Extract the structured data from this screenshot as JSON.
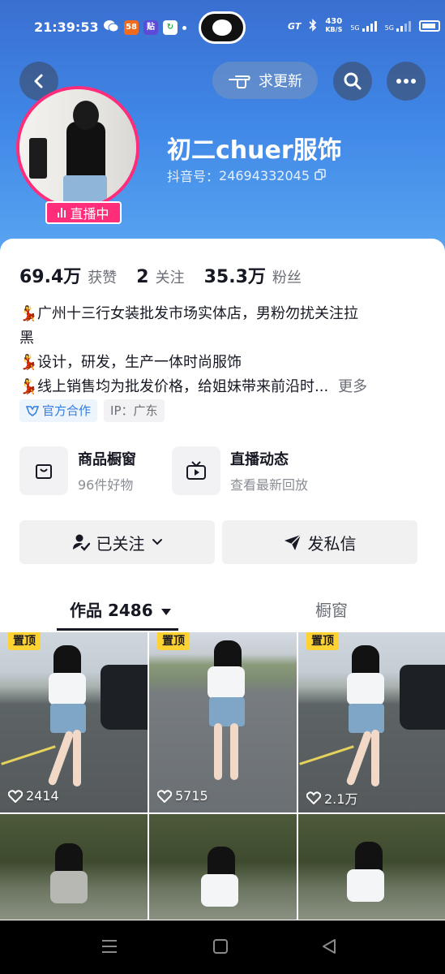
{
  "status_bar": {
    "time": "21:39:53",
    "net_speed": "430\nKB/S",
    "net_speed_value": "430",
    "net_speed_unit": "KB/S",
    "network_1": "5G",
    "network_2": "5G"
  },
  "header": {
    "update_request_label": "求更新",
    "profile_name": "初二chuer服饰",
    "douyin_id_label": "抖音号：",
    "douyin_id": "24694332045",
    "live_badge": "直播中"
  },
  "stats": [
    {
      "value": "69.4万",
      "label": "获赞"
    },
    {
      "value": "2",
      "label": "关注"
    },
    {
      "value": "35.3万",
      "label": "粉丝"
    }
  ],
  "bio": {
    "lines": [
      "广州十三行女装批发市场实体店，男粉勿扰关注拉",
      "黑",
      "设计，研发，生产一体时尚服饰",
      "线上销售均为批发价格，给姐妹带来前沿时..."
    ],
    "more_label": "更多"
  },
  "tags": {
    "official": "官方合作",
    "ip": "IP：广东"
  },
  "shortcuts": [
    {
      "title": "商品橱窗",
      "subtitle": "96件好物",
      "icon": "shopping-bag-icon"
    },
    {
      "title": "直播动态",
      "subtitle": "查看最新回放",
      "icon": "live-tv-icon"
    }
  ],
  "actions": {
    "follow_label": "已关注",
    "message_label": "发私信"
  },
  "tabs": {
    "works_label": "作品 2486",
    "showcase_label": "橱窗"
  },
  "videos": [
    {
      "pinned_label": "置顶",
      "likes": "2414"
    },
    {
      "pinned_label": "置顶",
      "likes": "5715"
    },
    {
      "pinned_label": "置顶",
      "likes": "2.1万"
    },
    {
      "pinned_label": "",
      "likes": ""
    },
    {
      "pinned_label": "",
      "likes": ""
    },
    {
      "pinned_label": "",
      "likes": ""
    }
  ],
  "colors": {
    "banner_start": "#3a6fd0",
    "banner_end": "#5aa6f2",
    "live_pink": "#ff2d7a",
    "pinned_yellow": "#ffd234",
    "official_blue": "#2f7de1"
  }
}
